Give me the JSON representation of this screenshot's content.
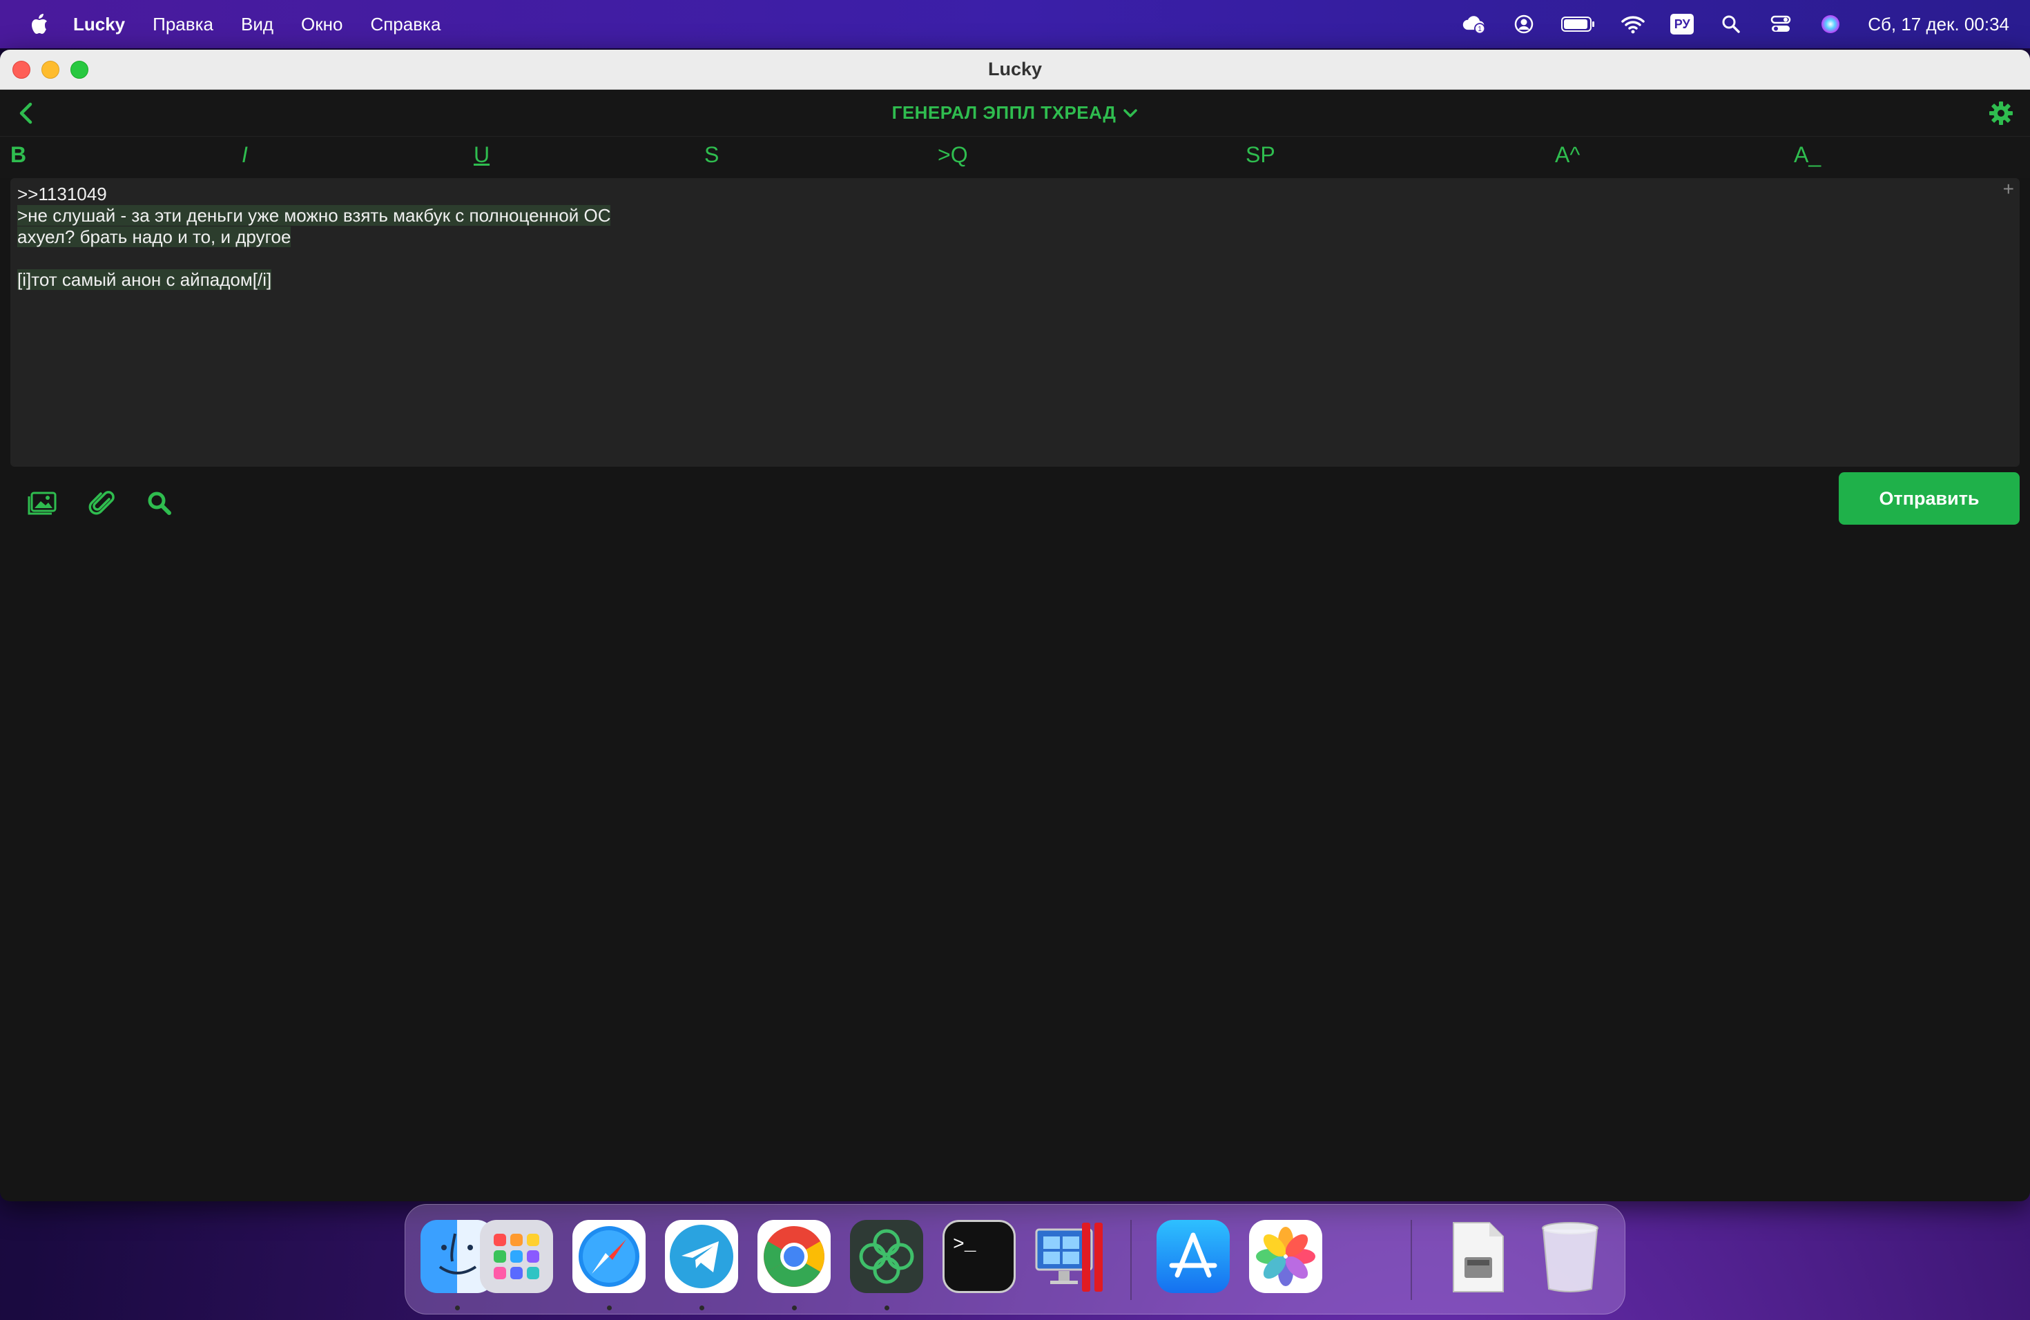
{
  "menubar": {
    "app_name": "Lucky",
    "items": [
      "Правка",
      "Вид",
      "Окно",
      "Справка"
    ],
    "keyboard_layout": "РУ",
    "clock": "Сб, 17 дек.  00:34",
    "status_icons": [
      "creative-cloud-icon",
      "user-icon",
      "battery-icon",
      "wifi-icon",
      "keyboard-layout-icon",
      "spotlight-search-icon",
      "control-center-icon",
      "siri-icon"
    ]
  },
  "window": {
    "title": "Lucky"
  },
  "navbar": {
    "thread_title": "ГЕНЕРАЛ ЭППЛ ТХРЕАД"
  },
  "format_bar": {
    "bold": "B",
    "italic": "I",
    "underline": "U",
    "strike": "S",
    "quote": ">Q",
    "spoiler": "SP",
    "sup": "A^",
    "sub": "A_"
  },
  "editor": {
    "lines": [
      ">>1131049",
      ">не слушай - за эти деньги уже можно взять макбук с полноценной ОС",
      "ахуел? брать надо и то, и другое",
      "",
      "[i]тот самый анон с айпадом[/i]"
    ]
  },
  "actions": {
    "send_label": "Отправить"
  },
  "colors": {
    "accent": "#2fbd4f",
    "send_button": "#1fb14a",
    "background": "#151515",
    "editor_bg": "#232323"
  },
  "dock": {
    "apps": [
      "Finder",
      "Launchpad",
      "Safari",
      "Telegram",
      "Chrome",
      "Lucky",
      "Terminal",
      "Parallels",
      "App Store",
      "Photos",
      "Disk Image",
      "Trash"
    ]
  }
}
